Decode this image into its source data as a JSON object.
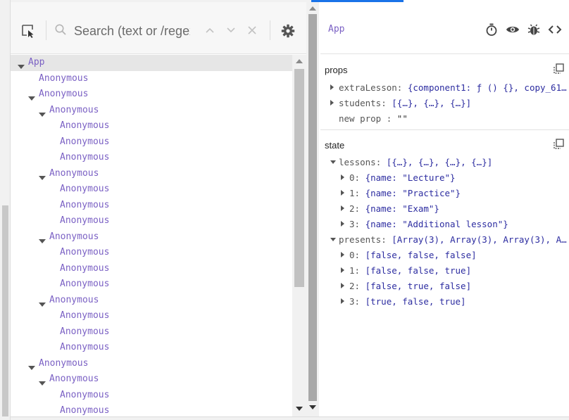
{
  "toolbar": {
    "search_placeholder": "Search (text or /regex/)",
    "icons": [
      "select-element-icon",
      "search-icon",
      "chevron-up-icon",
      "chevron-down-icon",
      "close-icon",
      "gear-icon"
    ]
  },
  "tree": [
    {
      "label": "App",
      "depth": 0,
      "expanded": true,
      "selected": true
    },
    {
      "label": "Anonymous",
      "depth": 1,
      "expanded": null
    },
    {
      "label": "Anonymous",
      "depth": 1,
      "expanded": true
    },
    {
      "label": "Anonymous",
      "depth": 2,
      "expanded": true
    },
    {
      "label": "Anonymous",
      "depth": 3,
      "expanded": null
    },
    {
      "label": "Anonymous",
      "depth": 3,
      "expanded": null
    },
    {
      "label": "Anonymous",
      "depth": 3,
      "expanded": null
    },
    {
      "label": "Anonymous",
      "depth": 2,
      "expanded": true
    },
    {
      "label": "Anonymous",
      "depth": 3,
      "expanded": null
    },
    {
      "label": "Anonymous",
      "depth": 3,
      "expanded": null
    },
    {
      "label": "Anonymous",
      "depth": 3,
      "expanded": null
    },
    {
      "label": "Anonymous",
      "depth": 2,
      "expanded": true
    },
    {
      "label": "Anonymous",
      "depth": 3,
      "expanded": null
    },
    {
      "label": "Anonymous",
      "depth": 3,
      "expanded": null
    },
    {
      "label": "Anonymous",
      "depth": 3,
      "expanded": null
    },
    {
      "label": "Anonymous",
      "depth": 2,
      "expanded": true
    },
    {
      "label": "Anonymous",
      "depth": 3,
      "expanded": null
    },
    {
      "label": "Anonymous",
      "depth": 3,
      "expanded": null
    },
    {
      "label": "Anonymous",
      "depth": 3,
      "expanded": null
    },
    {
      "label": "Anonymous",
      "depth": 1,
      "expanded": true
    },
    {
      "label": "Anonymous",
      "depth": 2,
      "expanded": true
    },
    {
      "label": "Anonymous",
      "depth": 3,
      "expanded": null
    },
    {
      "label": "Anonymous",
      "depth": 3,
      "expanded": null
    }
  ],
  "inspector": {
    "component_name": "App",
    "header_icons": [
      "stopwatch-icon",
      "eye-icon",
      "bug-icon",
      "code-icon"
    ],
    "props": {
      "title": "props",
      "rows": [
        {
          "key": "extraLesson",
          "value": "{component1: ƒ () {}, copy_61…",
          "toggle": "collapsed"
        },
        {
          "key": "students",
          "value": "[{…}, {…}, {…}]",
          "toggle": "collapsed"
        },
        {
          "key": "new prop",
          "value": "\"\"",
          "toggle": "none"
        }
      ]
    },
    "state": {
      "title": "state",
      "rows": [
        {
          "key": "lessons",
          "value": "[{…}, {…}, {…}, {…}]",
          "toggle": "expanded",
          "indent": 0
        },
        {
          "key": "0",
          "value": "{name: \"Lecture\"}",
          "toggle": "collapsed",
          "indent": 1
        },
        {
          "key": "1",
          "value": "{name: \"Practice\"}",
          "toggle": "collapsed",
          "indent": 1
        },
        {
          "key": "2",
          "value": "{name: \"Exam\"}",
          "toggle": "collapsed",
          "indent": 1
        },
        {
          "key": "3",
          "value": "{name: \"Additional lesson\"}",
          "toggle": "collapsed",
          "indent": 1
        },
        {
          "key": "presents",
          "value": "[Array(3), Array(3), Array(3), A…",
          "toggle": "expanded",
          "indent": 0
        },
        {
          "key": "0",
          "value": "[false, false, false]",
          "toggle": "collapsed",
          "indent": 1
        },
        {
          "key": "1",
          "value": "[false, false, true]",
          "toggle": "collapsed",
          "indent": 1
        },
        {
          "key": "2",
          "value": "[false, true, false]",
          "toggle": "collapsed",
          "indent": 1
        },
        {
          "key": "3",
          "value": "[true, false, true]",
          "toggle": "collapsed",
          "indent": 1
        }
      ]
    }
  },
  "colors": {
    "component": "#7b61c4",
    "value": "#2c2ca0",
    "accent": "#1a73e8"
  }
}
